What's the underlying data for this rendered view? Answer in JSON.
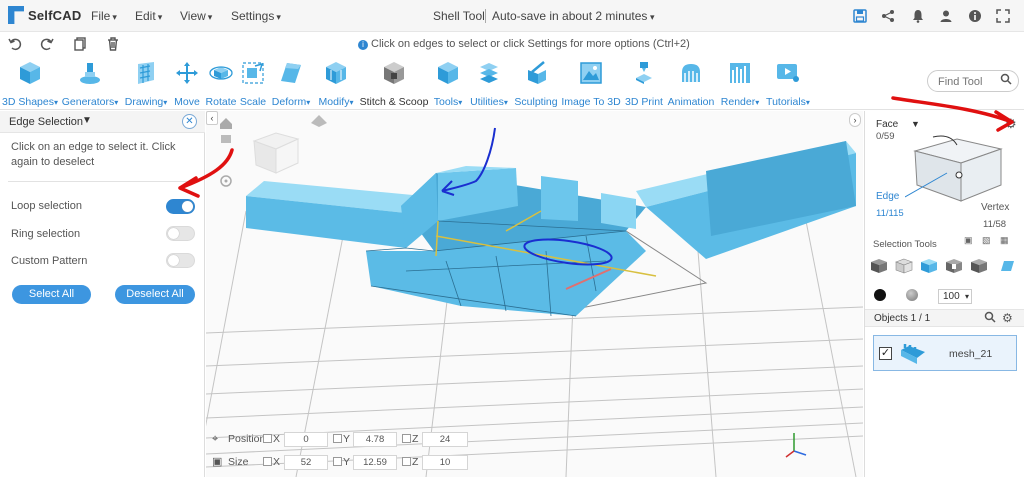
{
  "app": {
    "name": "SelfCAD",
    "document_title": "Shell Tool",
    "autosave": "Auto-save in about 2 minutes"
  },
  "menu": [
    "File",
    "Edit",
    "View",
    "Settings"
  ],
  "top_icons": [
    "save-icon",
    "share-icon",
    "notifications-icon",
    "account-icon",
    "info-icon",
    "fullscreen-icon"
  ],
  "hint": "Click on edges to select or click Settings for more options (Ctrl+2)",
  "toolbar": {
    "tools": [
      {
        "label": "3D Shapes",
        "dropdown": true
      },
      {
        "label": "Generators",
        "dropdown": true
      },
      {
        "label": "Drawing",
        "dropdown": true
      },
      {
        "label": "Move",
        "dropdown": false
      },
      {
        "label": "Rotate",
        "dropdown": false
      },
      {
        "label": "Scale",
        "dropdown": false
      },
      {
        "label": "Deform",
        "dropdown": true
      },
      {
        "label": "Modify",
        "dropdown": true
      },
      {
        "label": "Stitch & Scoop",
        "dropdown": false
      },
      {
        "label": "Tools",
        "dropdown": true
      },
      {
        "label": "Utilities",
        "dropdown": true
      },
      {
        "label": "Sculpting",
        "dropdown": false
      },
      {
        "label": "Image To 3D",
        "dropdown": false
      },
      {
        "label": "3D Print",
        "dropdown": false
      },
      {
        "label": "Animation",
        "dropdown": false
      },
      {
        "label": "Render",
        "dropdown": true
      },
      {
        "label": "Tutorials",
        "dropdown": true
      }
    ],
    "find_placeholder": "Find Tool"
  },
  "edge_panel": {
    "title": "Edge Selection",
    "description": "Click on an edge to select it. Click again to deselect",
    "options": [
      {
        "label": "Loop selection",
        "enabled": true
      },
      {
        "label": "Ring selection",
        "enabled": false
      },
      {
        "label": "Custom Pattern",
        "enabled": false
      }
    ],
    "select_all": "Select All",
    "deselect_all": "Deselect All"
  },
  "transform": {
    "position_label": "Position",
    "size_label": "Size",
    "position": {
      "x": "0",
      "y": "4.78",
      "z": "24"
    },
    "size": {
      "x": "52",
      "y": "12.59",
      "z": "10"
    },
    "axes": [
      "X",
      "Y",
      "Z"
    ]
  },
  "right_panel": {
    "face_label": "Face",
    "face_count": "0/59",
    "edge_label": "Edge",
    "edge_count": "11/115",
    "vertex_label": "Vertex",
    "vertex_count": "11/58",
    "selection_tools_label": "Selection Tools",
    "opacity": "100",
    "objects_label": "Objects 1 / 1",
    "object_name": "mesh_21"
  },
  "colors": {
    "accent": "#2e86d1",
    "mesh": "#5bbbe6",
    "annotation_red": "#e01010",
    "annotation_blue": "#1a2fd0"
  }
}
